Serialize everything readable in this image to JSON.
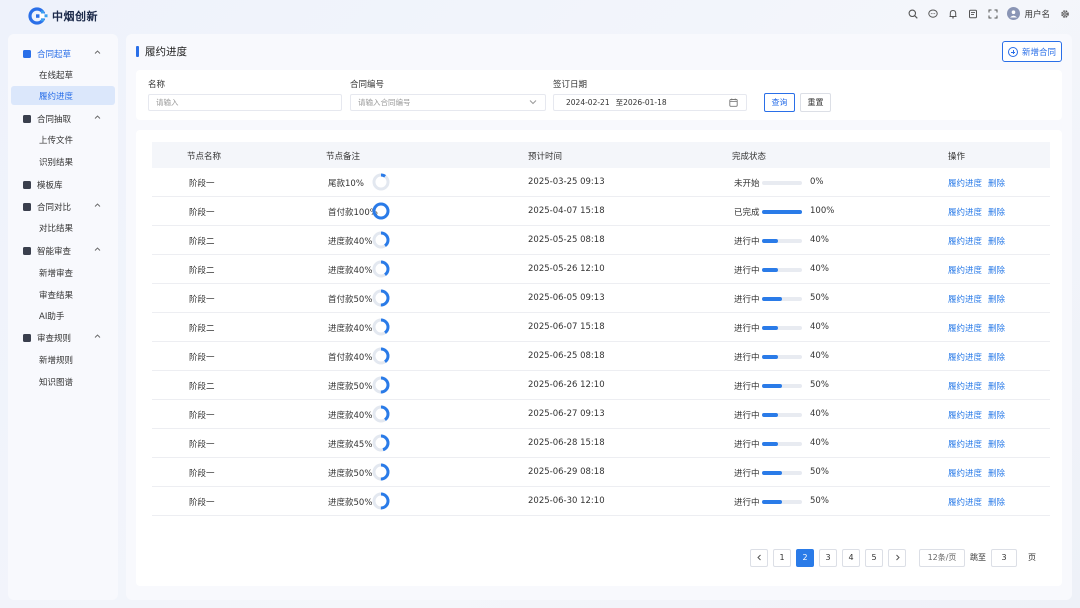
{
  "brand": {
    "name": "中烟创新",
    "accent": "#2a6fe8"
  },
  "header": {
    "icons": [
      "search-icon",
      "chat-icon",
      "bell-icon",
      "document-icon",
      "expand-icon"
    ],
    "username": "用户名"
  },
  "sidebar": {
    "items": [
      {
        "label": "合同起草",
        "icon": "dashboard-icon",
        "level": 1,
        "expanded": true,
        "active_parent": true
      },
      {
        "label": "在线起草",
        "level": 2
      },
      {
        "label": "履约进度",
        "level": 2,
        "active": true
      },
      {
        "label": "合同抽取",
        "icon": "extract-icon",
        "level": 1,
        "expanded": true
      },
      {
        "label": "上传文件",
        "level": 2
      },
      {
        "label": "识别结果",
        "level": 2
      },
      {
        "label": "模板库",
        "icon": "template-icon",
        "level": 1
      },
      {
        "label": "合同对比",
        "icon": "compare-icon",
        "level": 1,
        "expanded": true
      },
      {
        "label": "对比结果",
        "level": 2
      },
      {
        "label": "智能审查",
        "icon": "review-icon",
        "level": 1,
        "expanded": true
      },
      {
        "label": "新增审查",
        "level": 2
      },
      {
        "label": "审查结果",
        "level": 2
      },
      {
        "label": "AI助手",
        "level": 2
      },
      {
        "label": "审查规则",
        "icon": "rule-icon",
        "level": 1,
        "expanded": true
      },
      {
        "label": "新增规则",
        "level": 2
      },
      {
        "label": "知识图谱",
        "level": 2
      }
    ]
  },
  "page": {
    "title": "履约进度",
    "new_button": "新增合同"
  },
  "filter": {
    "name_label": "名称",
    "name_placeholder": "请输入",
    "code_label": "合同编号",
    "code_placeholder": "请输入合同编号",
    "date_label": "签订日期",
    "date_start": "2024-02-21",
    "date_end": "至2026-01-18",
    "query_button": "查询",
    "reset_button": "重置"
  },
  "table": {
    "headers": [
      "节点名称",
      "节点备注",
      "预计时间",
      "完成状态",
      "操作"
    ],
    "action_progress": "履约进度",
    "action_delete": "删除",
    "rows": [
      {
        "node": "阶段一",
        "note": "尾款10%",
        "pct_note": 10,
        "time": "2025-03-25  09:13",
        "status": "未开始",
        "progress": 0,
        "progress_label": "0%"
      },
      {
        "node": "阶段一",
        "note": "首付款100%",
        "pct_note": 100,
        "time": "2025-04-07  15:18",
        "status": "已完成",
        "progress": 100,
        "progress_label": "100%"
      },
      {
        "node": "阶段二",
        "note": "进度款40%",
        "pct_note": 40,
        "time": "2025-05-25  08:18",
        "status": "进行中",
        "progress": 40,
        "progress_label": "40%"
      },
      {
        "node": "阶段二",
        "note": "进度款40%",
        "pct_note": 40,
        "time": "2025-05-26  12:10",
        "status": "进行中",
        "progress": 40,
        "progress_label": "40%"
      },
      {
        "node": "阶段一",
        "note": "首付款50%",
        "pct_note": 50,
        "time": "2025-06-05  09:13",
        "status": "进行中",
        "progress": 50,
        "progress_label": "50%"
      },
      {
        "node": "阶段二",
        "note": "进度款40%",
        "pct_note": 40,
        "time": "2025-06-07  15:18",
        "status": "进行中",
        "progress": 40,
        "progress_label": "40%"
      },
      {
        "node": "阶段一",
        "note": "首付款40%",
        "pct_note": 40,
        "time": "2025-06-25  08:18",
        "status": "进行中",
        "progress": 40,
        "progress_label": "40%"
      },
      {
        "node": "阶段二",
        "note": "进度款50%",
        "pct_note": 50,
        "time": "2025-06-26  12:10",
        "status": "进行中",
        "progress": 50,
        "progress_label": "50%"
      },
      {
        "node": "阶段一",
        "note": "进度款40%",
        "pct_note": 40,
        "time": "2025-06-27  09:13",
        "status": "进行中",
        "progress": 40,
        "progress_label": "40%"
      },
      {
        "node": "阶段一",
        "note": "进度款45%",
        "pct_note": 45,
        "time": "2025-06-28  15:18",
        "status": "进行中",
        "progress": 40,
        "progress_label": "40%"
      },
      {
        "node": "阶段一",
        "note": "进度款50%",
        "pct_note": 50,
        "time": "2025-06-29  08:18",
        "status": "进行中",
        "progress": 50,
        "progress_label": "50%"
      },
      {
        "node": "阶段一",
        "note": "进度款50%",
        "pct_note": 50,
        "time": "2025-06-30  12:10",
        "status": "进行中",
        "progress": 50,
        "progress_label": "50%"
      }
    ]
  },
  "pagination": {
    "pages": [
      "1",
      "2",
      "3",
      "4",
      "5"
    ],
    "current": "2",
    "page_size": "12条/页",
    "jump_label": "跳至",
    "jump_value": "3",
    "page_unit": "页"
  }
}
